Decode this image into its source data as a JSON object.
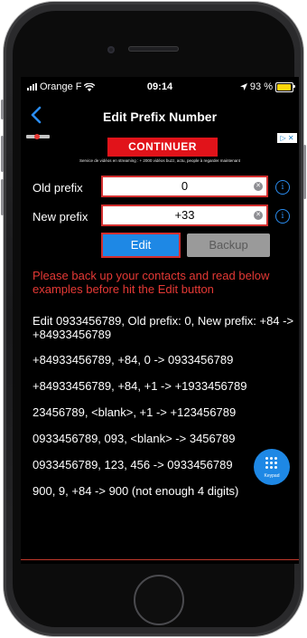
{
  "status_bar": {
    "carrier": "Orange F",
    "time": "09:14",
    "battery": "93 %",
    "battery_level": 0.93
  },
  "nav": {
    "title": "Edit Prefix Number"
  },
  "ad": {
    "cta_label": "CONTINUER",
    "tagline": "Service de vidéos en streaming : + 2000 vidéos buzz, actu, people à regarder maintenant",
    "choices_label": "▷ ✕"
  },
  "form": {
    "old_prefix_label": "Old prefix",
    "old_prefix_value": "0",
    "new_prefix_label": "New prefix",
    "new_prefix_value": "+33",
    "edit_label": "Edit",
    "backup_label": "Backup"
  },
  "warning": "Please back up your contacts and read below examples before hit the Edit button",
  "examples": [
    "Edit 0933456789, Old prefix: 0, New prefix: +84 -> +84933456789",
    "+84933456789, +84, 0 -> 0933456789",
    "+84933456789, +84, +1 -> +1933456789",
    "23456789, <blank>, +1 -> +123456789",
    "0933456789, 093, <blank> -> 3456789",
    "0933456789, 123, 456 -> 0933456789",
    "900, 9, +84 -> 900 (not enough 4 digits)"
  ],
  "keypad": {
    "label": "Keypad"
  },
  "colors": {
    "accent_blue": "#1e88e5",
    "warning_red": "#e53935",
    "field_border": "#d32f2f",
    "battery_yellow": "#ffd60a"
  }
}
